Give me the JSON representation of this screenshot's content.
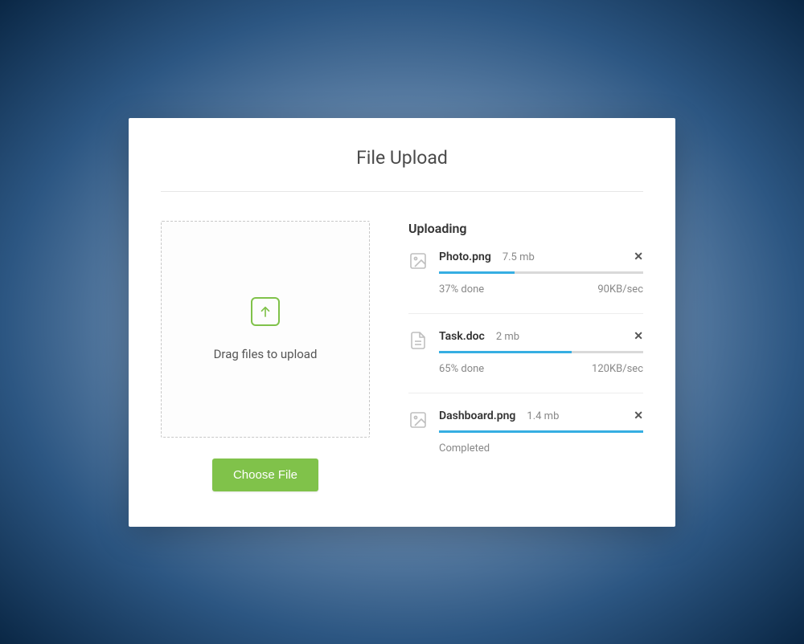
{
  "title": "File Upload",
  "dropzone": {
    "text": "Drag files to upload"
  },
  "choose_button": "Choose File",
  "uploading": {
    "title": "Uploading",
    "items": [
      {
        "icon": "image",
        "name": "Photo.png",
        "size": "7.5 mb",
        "progress_percent": 37,
        "status_left": "37% done",
        "status_right": "90KB/sec"
      },
      {
        "icon": "document",
        "name": "Task.doc",
        "size": "2 mb",
        "progress_percent": 65,
        "status_left": "65% done",
        "status_right": "120KB/sec"
      },
      {
        "icon": "image",
        "name": "Dashboard.png",
        "size": "1.4 mb",
        "progress_percent": 100,
        "status_left": "Completed",
        "status_right": ""
      }
    ]
  },
  "colors": {
    "accent_green": "#80c24a",
    "accent_blue": "#36aee2"
  }
}
